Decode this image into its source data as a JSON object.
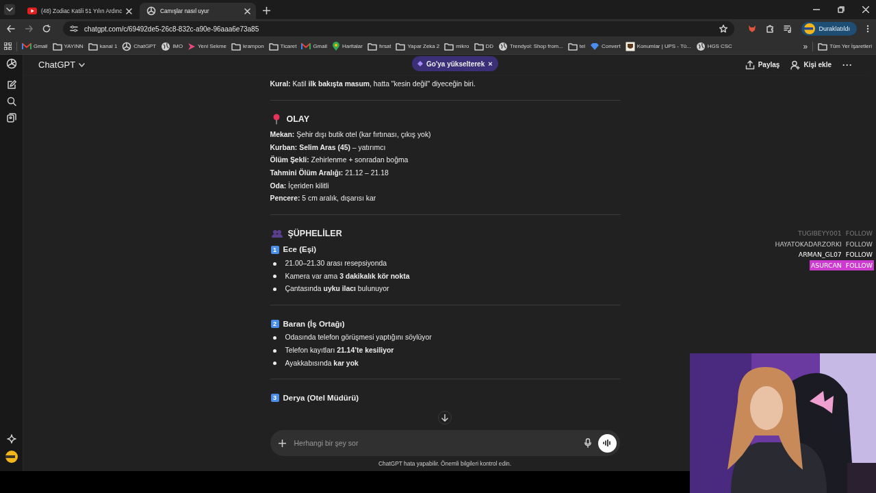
{
  "browser": {
    "tabs": [
      {
        "title": "(48) Zodiac Katili 51 Yılın Ardınc",
        "kind": "video",
        "selected": false
      },
      {
        "title": "Camışlar nasıl uyur",
        "kind": "logo",
        "selected": true
      }
    ],
    "address": "chatgpt.com/c/69492de5-26c8-832c-a90e-96aaa6e73a85",
    "profile": "Duraklatıldı",
    "bookmarks": [
      {
        "label": "Gmail",
        "kind": "mail"
      },
      {
        "label": "YAYINN",
        "kind": "folder"
      },
      {
        "label": "kanal 1",
        "kind": "folder"
      },
      {
        "label": "ChatGPT",
        "kind": "logo"
      },
      {
        "label": "IMO",
        "kind": "globe"
      },
      {
        "label": "Yeni Sekme",
        "kind": "play"
      },
      {
        "label": "krampon",
        "kind": "folder"
      },
      {
        "label": "Ticaret",
        "kind": "folder"
      },
      {
        "label": "Gmail",
        "kind": "mail"
      },
      {
        "label": "Haritalar",
        "kind": "pin"
      },
      {
        "label": "fırsat",
        "kind": "folder"
      },
      {
        "label": "Yapar Zeka 2",
        "kind": "folder"
      },
      {
        "label": "mikro",
        "kind": "folder"
      },
      {
        "label": "DD",
        "kind": "folder"
      },
      {
        "label": "Trendyol: Shop from...",
        "kind": "globe"
      },
      {
        "label": "tel",
        "kind": "folder"
      },
      {
        "label": "Convert",
        "kind": "gem"
      },
      {
        "label": "Konumlar | UPS - Tü...",
        "kind": "box"
      },
      {
        "label": "HGS CSC",
        "kind": "globe"
      }
    ],
    "more": "»",
    "all_bookmarks": "Tüm Yer İşaretleri"
  },
  "app": {
    "model": "ChatGPT",
    "upgrade": "Go'ya yükselterek",
    "upgrade_close": "×",
    "actions": [
      {
        "label": "Paylaş",
        "kind": "share"
      },
      {
        "label": "Kişi ekle",
        "kind": "person"
      }
    ],
    "more": "···"
  },
  "content": [
    {
      "kind": "para",
      "text": "**Kural:** Katil **ilk bakışta masum**, hatta \"kesin değil\" diyeceğin biri."
    },
    {
      "kind": "divider"
    },
    {
      "kind": "heading",
      "text": "OLAY"
    },
    {
      "kind": "para",
      "text": "**Mekan:** Şehir dışı butik otel (kar fırtınası, çıkış yok)"
    },
    {
      "kind": "para",
      "text": "**Kurban: Selim Aras (45)** – yatırımcı"
    },
    {
      "kind": "para",
      "text": "**Ölüm Şekli:** Zehirlenme + sonradan boğma"
    },
    {
      "kind": "para",
      "text": "**Tahmini Ölüm Aralığı:** 21.12 – 21.18"
    },
    {
      "kind": "para",
      "text": "**Oda:** İçeriden kilitli"
    },
    {
      "kind": "para",
      "text": "**Pencere:** 5 cm aralık, dışarısı kar"
    },
    {
      "kind": "divider"
    },
    {
      "kind": "heading",
      "text": "ŞÜPHELİLER"
    },
    {
      "kind": "subheading",
      "number": "1",
      "text": "Ece (Eşi)"
    },
    {
      "kind": "bullet",
      "text": "21.00–21.30 arası resepsiyonda"
    },
    {
      "kind": "bullet",
      "text": "Kamera var ama **3 dakikalık kör nokta**"
    },
    {
      "kind": "bullet",
      "text": "Çantasında **uyku ilacı** bulunuyor"
    },
    {
      "kind": "divider"
    },
    {
      "kind": "subheading",
      "number": "2",
      "text": "Baran (İş Ortağı)"
    },
    {
      "kind": "bullet",
      "text": "Odasında telefon görüşmesi yaptığını söylüyor"
    },
    {
      "kind": "bullet",
      "text": "Telefon kayıtları **21.14’te kesiliyor**"
    },
    {
      "kind": "bullet",
      "text": "Ayakkabısında **kar yok**"
    },
    {
      "kind": "divider"
    },
    {
      "kind": "subheading",
      "number": "3",
      "text": "Derya (Otel Müdürü)"
    }
  ],
  "composer": {
    "placeholder": "Herhangi bir şey sor"
  },
  "disclaimer": "ChatGPT hata yapabilir. Önemli bilgileri kontrol edin.",
  "alerts": [
    {
      "user": "TUGIBEYY001",
      "action": "FOLLOW",
      "kind": "faded"
    },
    {
      "user": "HAYATOKADARZORKI",
      "action": "FOLLOW",
      "kind": "normal"
    },
    {
      "user": "ARMAN_GL07",
      "action": "FOLLOW",
      "kind": "bright"
    },
    {
      "user": "ASURCAN",
      "action": "FOLLOW",
      "kind": "highlight"
    }
  ]
}
